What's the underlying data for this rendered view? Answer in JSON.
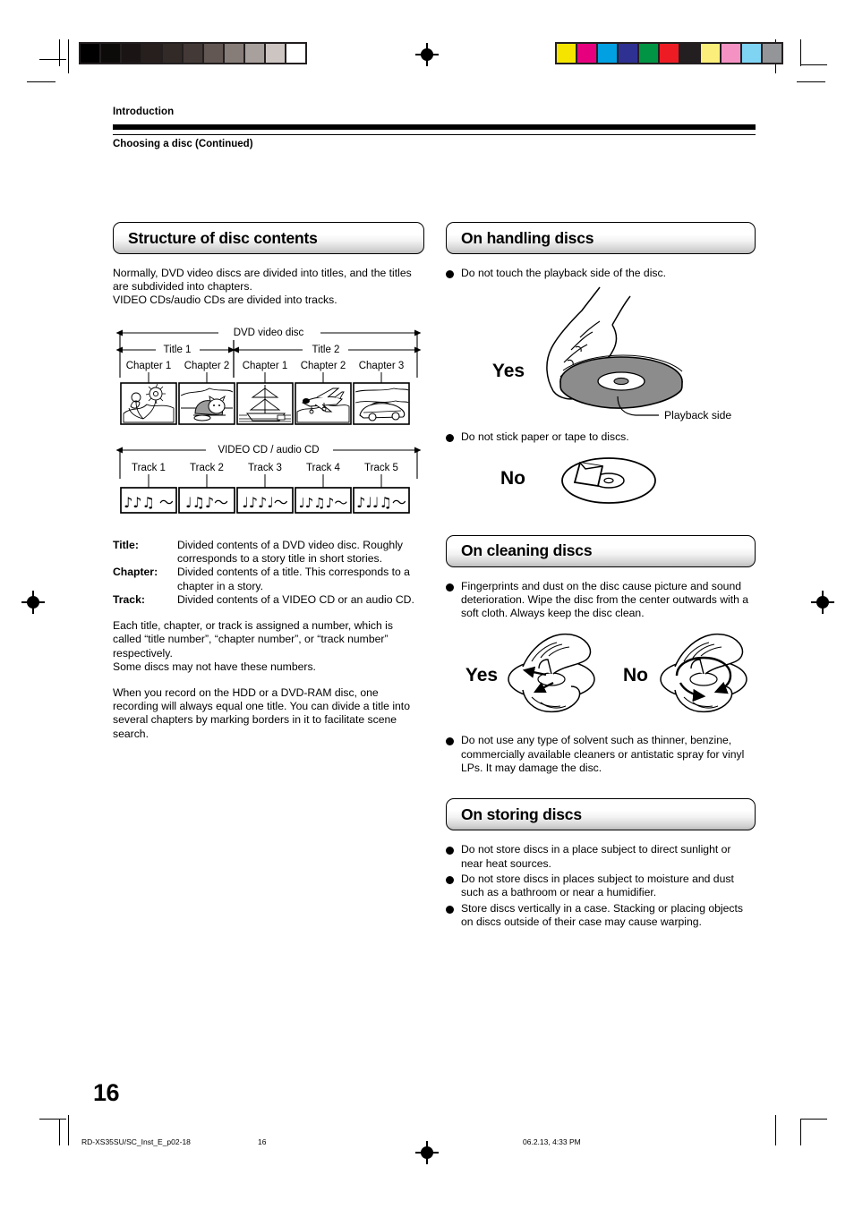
{
  "header": {
    "running_head": "Introduction",
    "sub_head": "Choosing a disc (Continued)"
  },
  "left_column": {
    "section_title": "Structure of disc contents",
    "intro_paragraph": "Normally, DVD video discs are divided into titles, and the titles are subdivided into chapters.\nVIDEO CDs/audio CDs are divided into tracks.",
    "dvd_diagram": {
      "top_label": "DVD video disc",
      "titles": [
        {
          "label": "Title 1",
          "chapters": [
            "Chapter 1",
            "Chapter 2"
          ]
        },
        {
          "label": "Title 2",
          "chapters": [
            "Chapter 1",
            "Chapter 2",
            "Chapter 3"
          ]
        }
      ],
      "thumbnails": [
        "flowers-scene",
        "cat-scene",
        "sailing-ship-scene",
        "airplane-scene",
        "car-scene"
      ]
    },
    "cd_diagram": {
      "top_label": "VIDEO CD / audio CD",
      "tracks": [
        "Track 1",
        "Track 2",
        "Track 3",
        "Track 4",
        "Track 5"
      ],
      "track_glyphs": [
        "♪♪♫ 〜",
        "♪♫♪〜",
        "♪♪♪♪〜",
        "♪♪♫♪〜",
        "♪♪♪♫〜"
      ]
    },
    "definitions": [
      {
        "term": "Title",
        "description": "Divided contents of a DVD video disc. Roughly corresponds to a story title in short stories."
      },
      {
        "term": "Chapter",
        "description": "Divided contents of a title. This corresponds to a chapter in a story."
      },
      {
        "term": "Track",
        "description": "Divided contents of a VIDEO CD or an audio CD."
      }
    ],
    "paragraph_2": "Each title, chapter, or track is assigned a number, which is called “title number”, “chapter number”, or “track number” respectively.\nSome discs may not have these numbers.",
    "paragraph_3": "When you record on the HDD or a DVD-RAM disc, one recording will always equal one title. You can divide a title into several chapters by marking borders in it to facilitate scene search."
  },
  "right_column": {
    "handling": {
      "section_title": "On handling discs",
      "bullet_1": "Do not touch the playback side of the disc.",
      "yes_label": "Yes",
      "playback_side_label": "Playback side",
      "bullet_2": "Do not stick paper or tape to discs.",
      "no_label": "No"
    },
    "cleaning": {
      "section_title": "On cleaning discs",
      "bullet_1": "Fingerprints and dust on the disc cause picture and sound deterioration. Wipe the disc from the center outwards with a soft cloth. Always keep the disc clean.",
      "yes_label": "Yes",
      "no_label": "No",
      "bullet_2": "Do not use any type of solvent such as thinner, benzine, commercially available cleaners or antistatic spray for vinyl LPs. It may damage the disc."
    },
    "storing": {
      "section_title": "On storing discs",
      "bullets": [
        "Do not store discs in a place subject to direct sunlight or near heat sources.",
        "Do not store discs in places subject to moisture and dust such as a bathroom or near a humidifier.",
        "Store discs vertically in a case. Stacking or placing objects on discs outside of their case may cause warping."
      ]
    }
  },
  "page_number": "16",
  "footer": {
    "file_slug": "RD-XS35SU/SC_Inst_E_p02-18",
    "page_slug": "16",
    "date_slug": "06.2.13, 4:33 PM"
  },
  "print_marks": {
    "greyscale_swatches": [
      "#000000",
      "#0d0a0a",
      "#1a1414",
      "#261f1d",
      "#322a27",
      "#433936",
      "#625753",
      "#867c78",
      "#a8a09c",
      "#cdc5c2",
      "#ffffff"
    ],
    "color_swatches": [
      "#f5e400",
      "#e6007e",
      "#00a0e2",
      "#2e3192",
      "#009444",
      "#ed1c24",
      "#231f20",
      "#fbee7a",
      "#f492c3",
      "#7fd4f4",
      "#939598"
    ]
  }
}
